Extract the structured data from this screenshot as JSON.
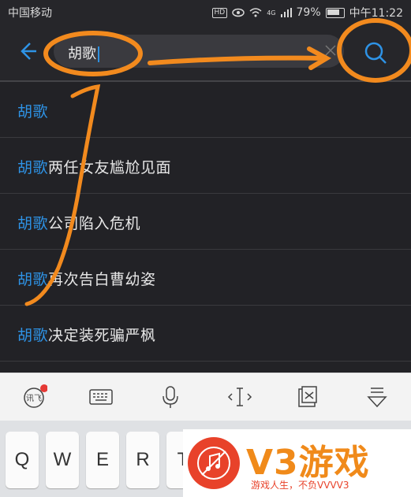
{
  "status_bar": {
    "carrier": "中国移动",
    "hd_badge": "HD",
    "network": "4G",
    "battery": "79%",
    "time": "中午11:22"
  },
  "search": {
    "query": "胡歌",
    "clear_icon": "close-icon",
    "search_icon": "search-icon"
  },
  "suggestions": [
    {
      "highlight": "胡歌",
      "rest": ""
    },
    {
      "highlight": "胡歌",
      "rest": "两任女友尴尬见面"
    },
    {
      "highlight": "胡歌",
      "rest": "公司陷入危机"
    },
    {
      "highlight": "胡歌",
      "rest": "再次告白曹幼姿"
    },
    {
      "highlight": "胡歌",
      "rest": "决定装死骗严枫"
    }
  ],
  "keyboard_toolbar": {
    "icons": [
      "iflytek-icon",
      "keyboard-icon",
      "microphone-icon",
      "cursor-icon",
      "clipboard-icon",
      "hide-keyboard-icon"
    ],
    "badge_color": "#e53935"
  },
  "keys": [
    "Q",
    "W",
    "E",
    "R",
    "T"
  ],
  "watermark": {
    "logo": "V3游戏",
    "tagline": "游戏人生，不负VVVV3"
  },
  "colors": {
    "accent": "#2e93e6",
    "annotation": "#f28a1e"
  }
}
